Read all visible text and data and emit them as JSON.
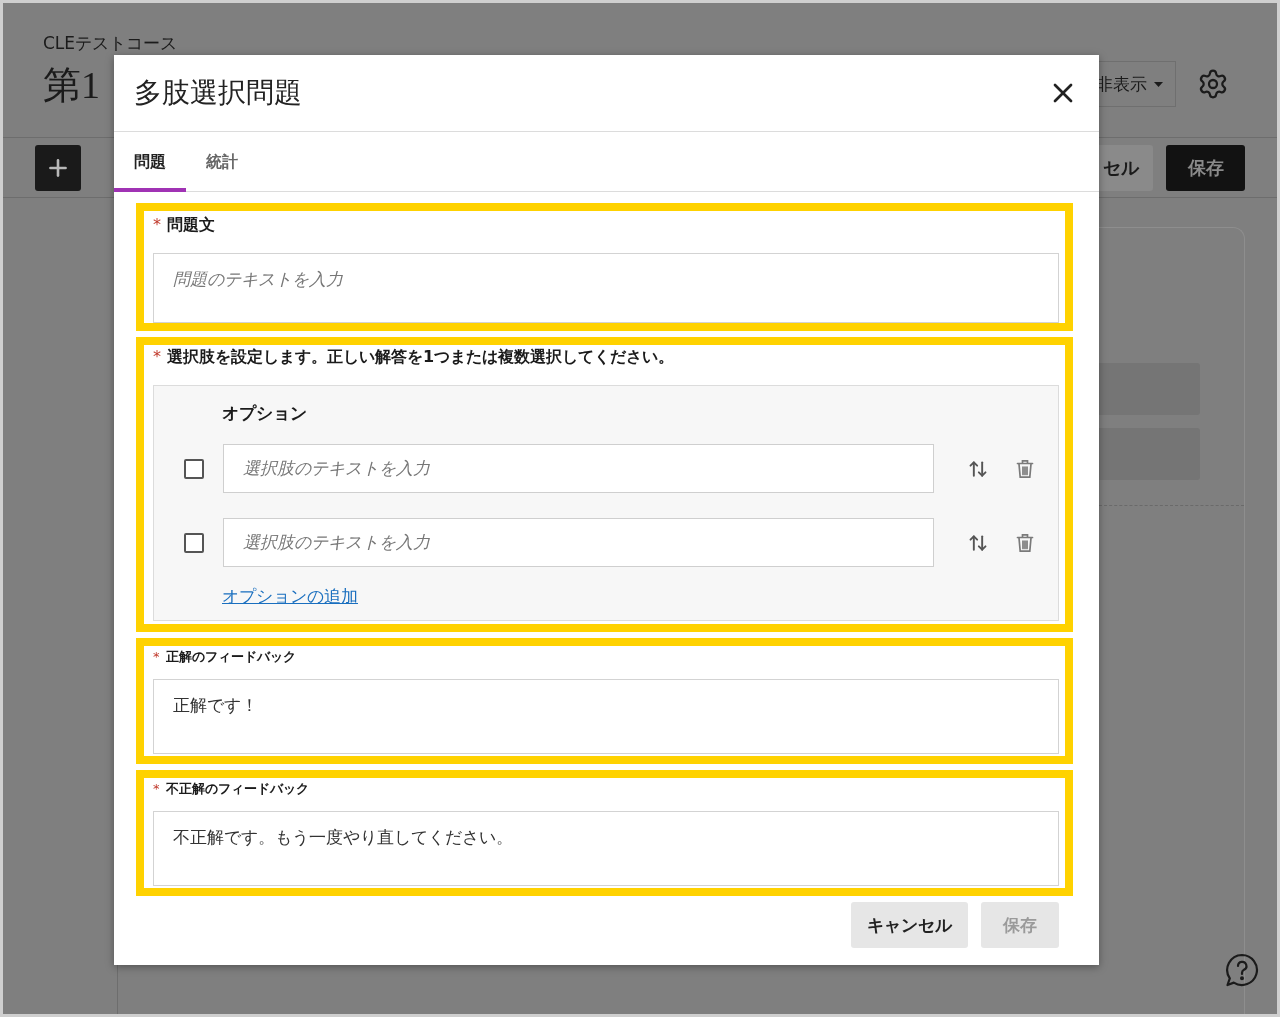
{
  "background_page": {
    "course_name": "CLEテストコース",
    "page_title": "第1",
    "visibility_dropdown": "非表示",
    "toolbar": {
      "cancel_button": "セル",
      "save_button": "保存"
    }
  },
  "dialog": {
    "title": "多肢選択問題",
    "tabs": [
      {
        "label": "問題",
        "selected": true
      },
      {
        "label": "統計",
        "selected": false
      }
    ],
    "sections": [
      {
        "kind": "question",
        "highlighted": true,
        "required_mark": "*",
        "label": "問題文",
        "field": {
          "placeholder": "問題のテキストを入力"
        }
      },
      {
        "kind": "options",
        "highlighted": true,
        "required_mark": "*",
        "label": "選択肢を設定します。正しい解答を1つまたは複数選択してください。",
        "options_heading": "オプション",
        "options": [
          {
            "checked": false,
            "placeholder": "選択肢のテキストを入力"
          },
          {
            "checked": false,
            "placeholder": "選択肢のテキストを入力"
          }
        ],
        "add_option_link": "オプションの追加"
      },
      {
        "kind": "feedback",
        "highlighted": true,
        "required_mark": "*",
        "label": "正解のフィードバック",
        "field": {
          "value": "正解です！"
        }
      },
      {
        "kind": "feedback",
        "highlighted": true,
        "required_mark": "*",
        "label": "不正解のフィードバック",
        "field": {
          "value": "不正解です。もう一度やり直してください。"
        }
      }
    ],
    "buttons": [
      {
        "label": "キャンセル",
        "disabled": false
      },
      {
        "label": "保存",
        "disabled": true
      }
    ]
  }
}
